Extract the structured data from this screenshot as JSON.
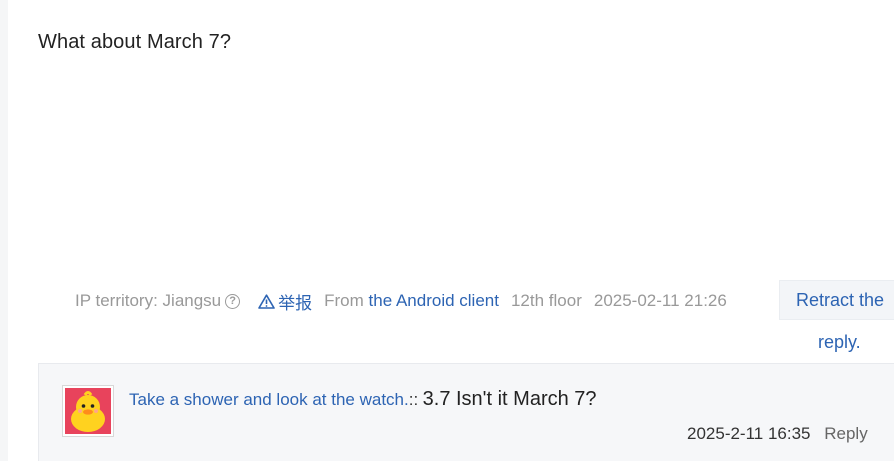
{
  "post": {
    "content": "What about March 7?"
  },
  "tail": {
    "ip_territory": "IP territory: Jiangsu",
    "help_icon": "question-circle-icon",
    "report_label": "举报",
    "report_icon": "warning-triangle-icon",
    "from_label": "From",
    "client_link": "the Android client",
    "floor": "12th floor",
    "datetime": "2025-02-11 21:26"
  },
  "retract": {
    "line1": "Retract the",
    "line2": "reply."
  },
  "sub_reply": {
    "author": "Take a shower and look at the watch.",
    "separator": "::",
    "text": "3.7 Isn't it March 7?",
    "time": "2025-2-11 16:35",
    "reply_label": "Reply",
    "avatar_icon": "yellow-duck-avatar"
  },
  "colors": {
    "link": "#2d64b3",
    "meta": "#999999",
    "reply_bg": "#f6f7f9",
    "avatar_bg": "#e8435c"
  }
}
